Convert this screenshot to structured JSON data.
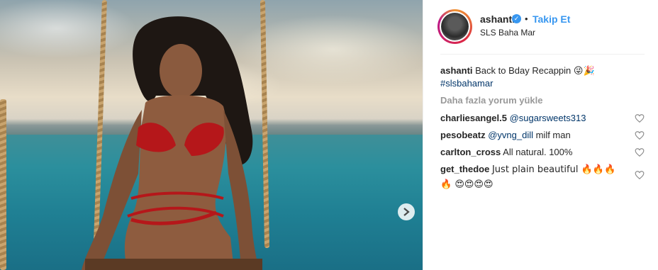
{
  "post": {
    "username": "ashanti",
    "follow_label": "Takip Et",
    "location": "SLS Baha Mar",
    "caption": {
      "user": "ashanti",
      "text": "Back to Bday Recappin 😜🎉",
      "hashtag": "#slsbahamar"
    },
    "load_more_label": "Daha fazla yorum yükle",
    "comments": [
      {
        "user": "charliesangel.5",
        "mention": "@sugarsweets313",
        "text": ""
      },
      {
        "user": "pesobeatz",
        "mention": "@yvng_dill",
        "text": " milf man"
      },
      {
        "user": "carlton_cross",
        "mention": "",
        "text": "All natural. 100%"
      },
      {
        "user": "get_thedoe",
        "mention": "",
        "text": "Just plain beautiful 🔥🔥🔥🔥 😍😍😍😍"
      }
    ]
  },
  "icons": {
    "verified": "verified-badge-icon",
    "heart": "heart-outline-icon",
    "next": "chevron-right-icon"
  },
  "colors": {
    "accent": "#3897f0",
    "link": "#003569",
    "muted": "#999999"
  }
}
